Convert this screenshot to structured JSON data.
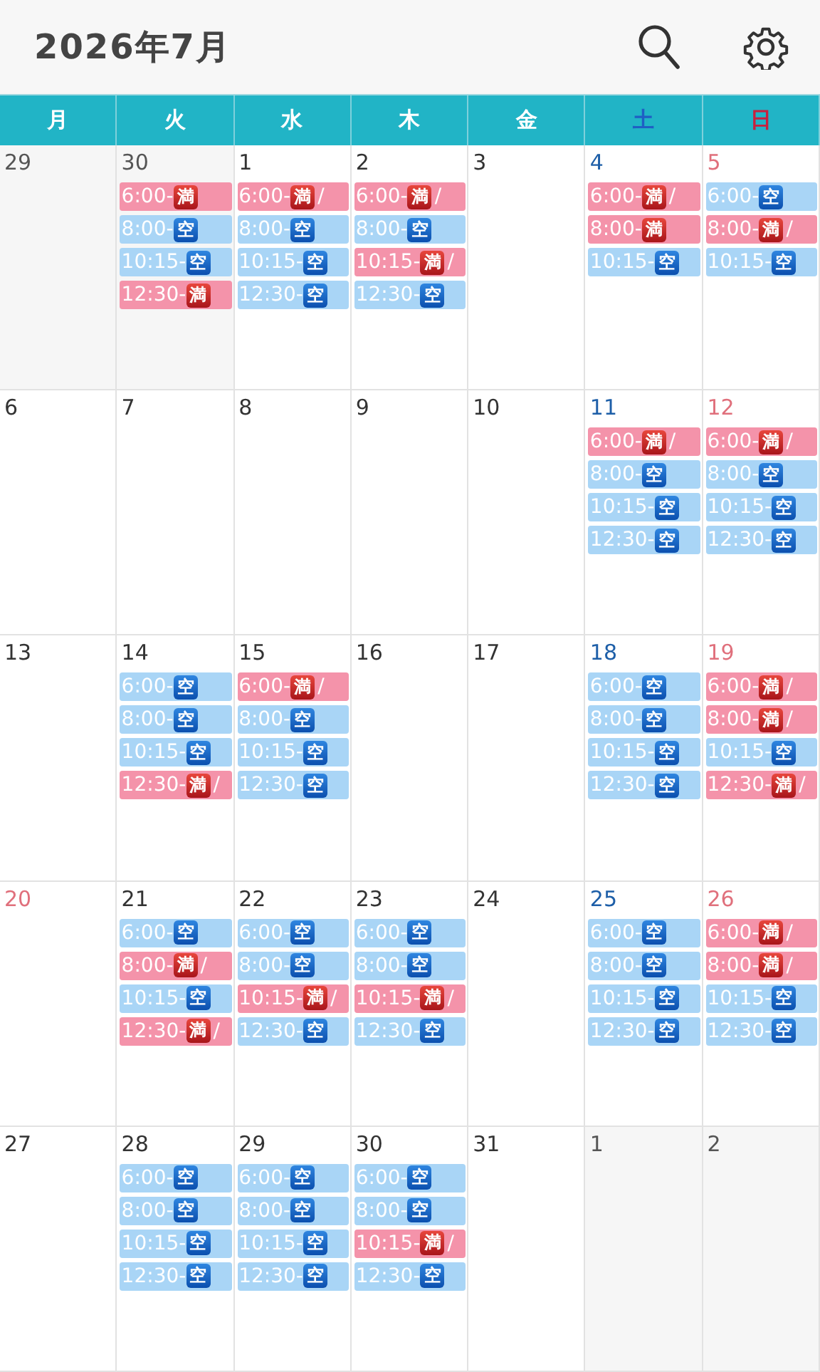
{
  "title": "2026年7月",
  "weekdays": [
    {
      "label": "月",
      "kind": "weekday"
    },
    {
      "label": "火",
      "kind": "weekday"
    },
    {
      "label": "水",
      "kind": "weekday"
    },
    {
      "label": "木",
      "kind": "weekday"
    },
    {
      "label": "金",
      "kind": "weekday"
    },
    {
      "label": "土",
      "kind": "saturday"
    },
    {
      "label": "日",
      "kind": "holiday"
    }
  ],
  "weeks": [
    {
      "days": [
        {
          "date": "29",
          "outside": true
        },
        {
          "date": "30",
          "outside": true,
          "events": [
            {
              "time": "6:00-",
              "badge": "満",
              "kind": "full"
            },
            {
              "time": "8:00-",
              "badge": "空",
              "kind": "open"
            },
            {
              "time": "10:15-",
              "badge": "空",
              "kind": "open"
            },
            {
              "time": "12:30-",
              "badge": "満",
              "kind": "full"
            }
          ]
        },
        {
          "date": "1",
          "kind": "weekday",
          "outside": false,
          "events": [
            {
              "time": "6:00-",
              "badge": "満",
              "kind": "full",
              "suffix": "/"
            },
            {
              "time": "8:00-",
              "badge": "空",
              "kind": "open"
            },
            {
              "time": "10:15-",
              "badge": "空",
              "kind": "open"
            },
            {
              "time": "12:30-",
              "badge": "空",
              "kind": "open"
            }
          ]
        },
        {
          "date": "2",
          "kind": "weekday",
          "outside": false,
          "events": [
            {
              "time": "6:00-",
              "badge": "満",
              "kind": "full",
              "suffix": "/"
            },
            {
              "time": "8:00-",
              "badge": "空",
              "kind": "open"
            },
            {
              "time": "10:15-",
              "badge": "満",
              "kind": "full",
              "suffix": "/"
            },
            {
              "time": "12:30-",
              "badge": "空",
              "kind": "open"
            }
          ]
        },
        {
          "date": "3",
          "kind": "weekday",
          "outside": false
        },
        {
          "date": "4",
          "kind": "saturday",
          "outside": false,
          "events": [
            {
              "time": "6:00-",
              "badge": "満",
              "kind": "full",
              "suffix": "/"
            },
            {
              "time": "8:00-",
              "badge": "満",
              "kind": "full"
            },
            {
              "time": "10:15-",
              "badge": "空",
              "kind": "open"
            }
          ]
        },
        {
          "date": "5",
          "kind": "holiday",
          "outside": false,
          "events": [
            {
              "time": "6:00-",
              "badge": "空",
              "kind": "open"
            },
            {
              "time": "8:00-",
              "badge": "満",
              "kind": "full",
              "suffix": "/"
            },
            {
              "time": "10:15-",
              "badge": "空",
              "kind": "open"
            }
          ]
        }
      ]
    },
    {
      "days": [
        {
          "date": "6",
          "kind": "weekday",
          "outside": false
        },
        {
          "date": "7",
          "kind": "weekday",
          "outside": false
        },
        {
          "date": "8",
          "kind": "weekday",
          "outside": false
        },
        {
          "date": "9",
          "kind": "weekday",
          "outside": false
        },
        {
          "date": "10",
          "kind": "weekday",
          "outside": false
        },
        {
          "date": "11",
          "kind": "saturday",
          "outside": false,
          "events": [
            {
              "time": "6:00-",
              "badge": "満",
              "kind": "full",
              "suffix": "/"
            },
            {
              "time": "8:00-",
              "badge": "空",
              "kind": "open"
            },
            {
              "time": "10:15-",
              "badge": "空",
              "kind": "open"
            },
            {
              "time": "12:30-",
              "badge": "空",
              "kind": "open"
            }
          ]
        },
        {
          "date": "12",
          "kind": "holiday",
          "outside": false,
          "events": [
            {
              "time": "6:00-",
              "badge": "満",
              "kind": "full",
              "suffix": "/"
            },
            {
              "time": "8:00-",
              "badge": "空",
              "kind": "open"
            },
            {
              "time": "10:15-",
              "badge": "空",
              "kind": "open"
            },
            {
              "time": "12:30-",
              "badge": "空",
              "kind": "open"
            }
          ]
        }
      ]
    },
    {
      "days": [
        {
          "date": "13",
          "kind": "weekday",
          "outside": false
        },
        {
          "date": "14",
          "kind": "weekday",
          "outside": false,
          "events": [
            {
              "time": "6:00-",
              "badge": "空",
              "kind": "open"
            },
            {
              "time": "8:00-",
              "badge": "空",
              "kind": "open"
            },
            {
              "time": "10:15-",
              "badge": "空",
              "kind": "open"
            },
            {
              "time": "12:30-",
              "badge": "満",
              "kind": "full",
              "suffix": "/"
            }
          ]
        },
        {
          "date": "15",
          "kind": "weekday",
          "outside": false,
          "events": [
            {
              "time": "6:00-",
              "badge": "満",
              "kind": "full",
              "suffix": "/"
            },
            {
              "time": "8:00-",
              "badge": "空",
              "kind": "open"
            },
            {
              "time": "10:15-",
              "badge": "空",
              "kind": "open"
            },
            {
              "time": "12:30-",
              "badge": "空",
              "kind": "open"
            }
          ]
        },
        {
          "date": "16",
          "kind": "weekday",
          "outside": false
        },
        {
          "date": "17",
          "kind": "weekday",
          "outside": false
        },
        {
          "date": "18",
          "kind": "saturday",
          "outside": false,
          "events": [
            {
              "time": "6:00-",
              "badge": "空",
              "kind": "open"
            },
            {
              "time": "8:00-",
              "badge": "空",
              "kind": "open"
            },
            {
              "time": "10:15-",
              "badge": "空",
              "kind": "open"
            },
            {
              "time": "12:30-",
              "badge": "空",
              "kind": "open"
            }
          ]
        },
        {
          "date": "19",
          "kind": "holiday",
          "outside": false,
          "events": [
            {
              "time": "6:00-",
              "badge": "満",
              "kind": "full",
              "suffix": "/"
            },
            {
              "time": "8:00-",
              "badge": "満",
              "kind": "full",
              "suffix": "/"
            },
            {
              "time": "10:15-",
              "badge": "空",
              "kind": "open"
            },
            {
              "time": "12:30-",
              "badge": "満",
              "kind": "full",
              "suffix": "/"
            }
          ]
        }
      ]
    },
    {
      "days": [
        {
          "date": "20",
          "kind": "holiday",
          "outside": false
        },
        {
          "date": "21",
          "kind": "weekday",
          "outside": false,
          "events": [
            {
              "time": "6:00-",
              "badge": "空",
              "kind": "open"
            },
            {
              "time": "8:00-",
              "badge": "満",
              "kind": "full",
              "suffix": "/"
            },
            {
              "time": "10:15-",
              "badge": "空",
              "kind": "open"
            },
            {
              "time": "12:30-",
              "badge": "満",
              "kind": "full",
              "suffix": "/"
            }
          ]
        },
        {
          "date": "22",
          "kind": "weekday",
          "outside": false,
          "events": [
            {
              "time": "6:00-",
              "badge": "空",
              "kind": "open"
            },
            {
              "time": "8:00-",
              "badge": "空",
              "kind": "open"
            },
            {
              "time": "10:15-",
              "badge": "満",
              "kind": "full",
              "suffix": "/"
            },
            {
              "time": "12:30-",
              "badge": "空",
              "kind": "open"
            }
          ]
        },
        {
          "date": "23",
          "kind": "weekday",
          "outside": false,
          "events": [
            {
              "time": "6:00-",
              "badge": "空",
              "kind": "open"
            },
            {
              "time": "8:00-",
              "badge": "空",
              "kind": "open"
            },
            {
              "time": "10:15-",
              "badge": "満",
              "kind": "full",
              "suffix": "/"
            },
            {
              "time": "12:30-",
              "badge": "空",
              "kind": "open"
            }
          ]
        },
        {
          "date": "24",
          "kind": "weekday",
          "outside": false
        },
        {
          "date": "25",
          "kind": "saturday",
          "outside": false,
          "events": [
            {
              "time": "6:00-",
              "badge": "空",
              "kind": "open"
            },
            {
              "time": "8:00-",
              "badge": "空",
              "kind": "open"
            },
            {
              "time": "10:15-",
              "badge": "空",
              "kind": "open"
            },
            {
              "time": "12:30-",
              "badge": "空",
              "kind": "open"
            }
          ]
        },
        {
          "date": "26",
          "kind": "holiday",
          "outside": false,
          "events": [
            {
              "time": "6:00-",
              "badge": "満",
              "kind": "full",
              "suffix": "/"
            },
            {
              "time": "8:00-",
              "badge": "満",
              "kind": "full",
              "suffix": "/"
            },
            {
              "time": "10:15-",
              "badge": "空",
              "kind": "open"
            },
            {
              "time": "12:30-",
              "badge": "空",
              "kind": "open"
            }
          ]
        }
      ]
    },
    {
      "days": [
        {
          "date": "27",
          "kind": "weekday",
          "outside": false
        },
        {
          "date": "28",
          "kind": "weekday",
          "outside": false,
          "events": [
            {
              "time": "6:00-",
              "badge": "空",
              "kind": "open"
            },
            {
              "time": "8:00-",
              "badge": "空",
              "kind": "open"
            },
            {
              "time": "10:15-",
              "badge": "空",
              "kind": "open"
            },
            {
              "time": "12:30-",
              "badge": "空",
              "kind": "open"
            }
          ]
        },
        {
          "date": "29",
          "kind": "weekday",
          "outside": false,
          "events": [
            {
              "time": "6:00-",
              "badge": "空",
              "kind": "open"
            },
            {
              "time": "8:00-",
              "badge": "空",
              "kind": "open"
            },
            {
              "time": "10:15-",
              "badge": "空",
              "kind": "open"
            },
            {
              "time": "12:30-",
              "badge": "空",
              "kind": "open"
            }
          ]
        },
        {
          "date": "30",
          "kind": "weekday",
          "outside": false,
          "events": [
            {
              "time": "6:00-",
              "badge": "空",
              "kind": "open"
            },
            {
              "time": "8:00-",
              "badge": "空",
              "kind": "open"
            },
            {
              "time": "10:15-",
              "badge": "満",
              "kind": "full",
              "suffix": "/"
            },
            {
              "time": "12:30-",
              "badge": "空",
              "kind": "open"
            }
          ]
        },
        {
          "date": "31",
          "kind": "weekday",
          "outside": false
        },
        {
          "date": "1",
          "outside": true
        },
        {
          "date": "2",
          "outside": true
        }
      ]
    }
  ]
}
